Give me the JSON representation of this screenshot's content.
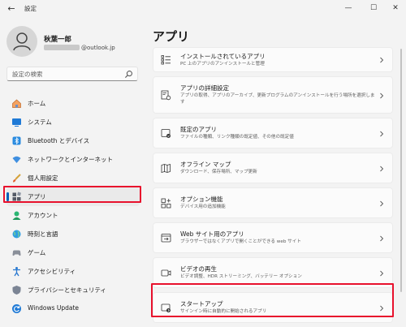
{
  "window": {
    "title": "設定",
    "back_glyph": "←",
    "controls": {
      "minimize": "—",
      "maximize": "☐",
      "close": "✕"
    }
  },
  "user": {
    "name": "秋葉一郎",
    "email_domain": "@outlook.jp"
  },
  "search": {
    "placeholder": "設定の検索"
  },
  "nav": {
    "items": [
      {
        "label": "ホーム",
        "icon": "home-icon"
      },
      {
        "label": "システム",
        "icon": "system-icon"
      },
      {
        "label": "Bluetooth とデバイス",
        "icon": "bluetooth-icon"
      },
      {
        "label": "ネットワークとインターネット",
        "icon": "network-icon"
      },
      {
        "label": "個人用設定",
        "icon": "brush-icon"
      },
      {
        "label": "アプリ",
        "icon": "apps-icon",
        "selected": true
      },
      {
        "label": "アカウント",
        "icon": "account-icon"
      },
      {
        "label": "時刻と言語",
        "icon": "globe-icon"
      },
      {
        "label": "ゲーム",
        "icon": "game-icon"
      },
      {
        "label": "アクセシビリティ",
        "icon": "accessibility-icon"
      },
      {
        "label": "プライバシーとセキュリティ",
        "icon": "shield-icon"
      },
      {
        "label": "Windows Update",
        "icon": "update-icon"
      }
    ]
  },
  "main": {
    "title": "アプリ",
    "cards": [
      {
        "title": "インストールされているアプリ",
        "subtitle": "PC 上のアプリのアンインストールと管理",
        "icon": "installed-apps-icon"
      },
      {
        "title": "アプリの詳細設定",
        "subtitle": "アプリの取得、アプリのアーカイブ、更新プログラムのアンインストールを行う場所を選択します",
        "icon": "advanced-settings-icon"
      },
      {
        "title": "既定のアプリ",
        "subtitle": "ファイルの種類、リンク種類の既定値、その他の既定値",
        "icon": "default-apps-icon"
      },
      {
        "title": "オフライン マップ",
        "subtitle": "ダウンロード、保存場所、マップ更新",
        "icon": "offline-maps-icon"
      },
      {
        "title": "オプション機能",
        "subtitle": "デバイス用の追加機能",
        "icon": "optional-features-icon"
      },
      {
        "title": "Web サイト用のアプリ",
        "subtitle": "ブラウザーではなくアプリで開くことができる web サイト",
        "icon": "web-apps-icon"
      },
      {
        "title": "ビデオの再生",
        "subtitle": "ビデオ調整、HDR ストリーミング、バッテリー オプション",
        "icon": "video-playback-icon"
      },
      {
        "title": "スタートアップ",
        "subtitle": "サインイン時に自動的に開始されるアプリ",
        "icon": "startup-icon"
      }
    ]
  },
  "colors": {
    "accent": "#005fb8",
    "highlight": "#e8112d",
    "background": "#f3f3f3",
    "card": "#fbfbfb"
  }
}
